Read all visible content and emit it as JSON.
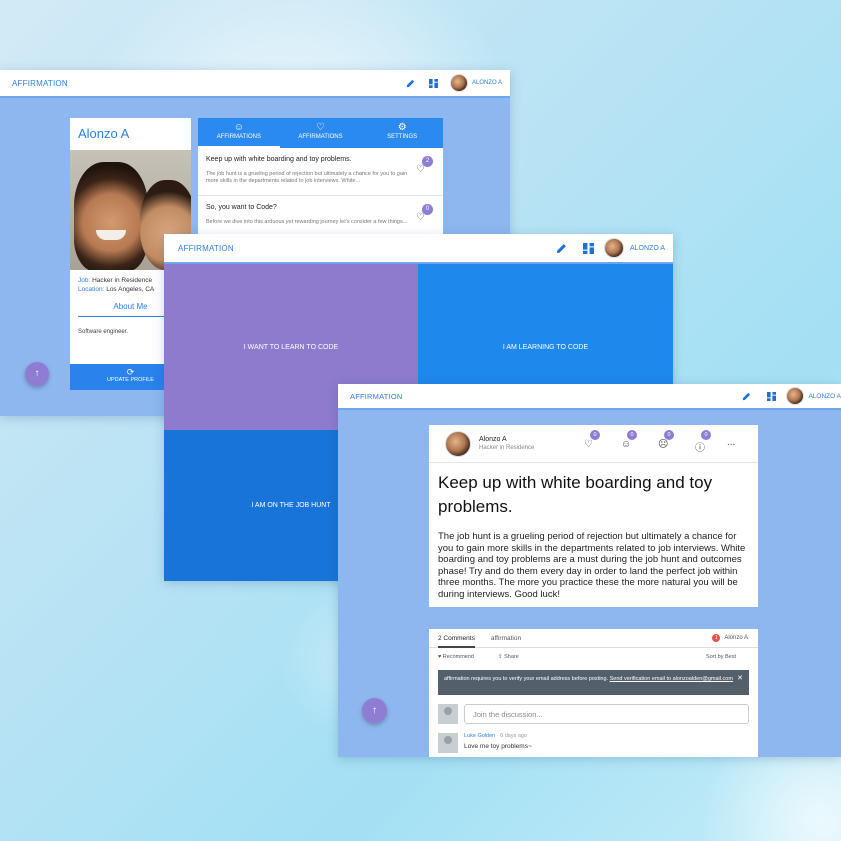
{
  "win1": {
    "brand": "AFFIRMATION",
    "edit_icon": "pencil-icon",
    "dashboard_icon": "dashboard-icon",
    "user": "ALONZO A",
    "profile": {
      "name": "Alonzo A",
      "job_label": "Job:",
      "job": "Hacker in Residence",
      "location_label": "Location:",
      "location": "Los Angeles, CA",
      "about_heading": "About Me",
      "bio": "Software engineer.",
      "update_button": "UPDATE PROFILE"
    },
    "tabs": [
      "AFFIRMATIONS",
      "AFFIRMATIONS",
      "SETTINGS"
    ],
    "items": [
      {
        "title": "Keep up with white boarding and toy problems.",
        "desc": "The job hunt is a grueling period of rejection but ultimately a chance for you to gain more skills in the departments related to job interviews. White...",
        "count": "2"
      },
      {
        "title": "So, you want to Code?",
        "desc": "Before we dive into this arduous yet rewarding journey let's consider a few things...",
        "count": "0"
      }
    ]
  },
  "win2": {
    "brand": "AFFIRMATION",
    "user": "ALONZO A",
    "tiles": [
      "I WANT TO LEARN TO CODE",
      "I AM LEARNING TO CODE",
      "I AM ON THE JOB HUNT",
      ""
    ]
  },
  "win3": {
    "brand": "AFFIRMATION",
    "user": "ALONZO A",
    "post": {
      "author": "Alonzo A",
      "role": "Hacker in Residence",
      "reactions": [
        {
          "icon": "heart-icon",
          "count": "0"
        },
        {
          "icon": "smile-icon",
          "count": "0"
        },
        {
          "icon": "sad-icon",
          "count": "0"
        },
        {
          "icon": "alert-icon",
          "count": "0"
        }
      ],
      "more": "...",
      "title": "Keep up with white boarding and toy problems.",
      "body": "The job hunt is a grueling period of rejection but ultimately a chance for you to gain more skills in the departments related to job interviews. White boarding and toy problems are a must during the job hunt and outcomes phase! Try and do them every day in order to land the perfect job within three months. The more you practice these the more natural you will be during interviews. Good luck!"
    },
    "disqus": {
      "tab_comments": "2 Comments",
      "tab_site": "affirmation",
      "notif_count": "1",
      "user": "Alonzo A",
      "recommend": "Recommend",
      "share": "Share",
      "sort": "Sort by Best",
      "warning_text": "affirmation requires you to verify your email address before posting.",
      "warning_link": "Send verification email to alonzoalden@gmail.com",
      "placeholder": "Join the discussion...",
      "comment_author": "Luke Golden",
      "comment_time": "6 days ago",
      "comment_text": "Love me toy problems~"
    }
  },
  "colors": {
    "brand_blue": "#2a7fe3",
    "purple": "#8e7bcd",
    "tile_blue": "#1e88ec",
    "frame_blue": "#8db7ee"
  }
}
